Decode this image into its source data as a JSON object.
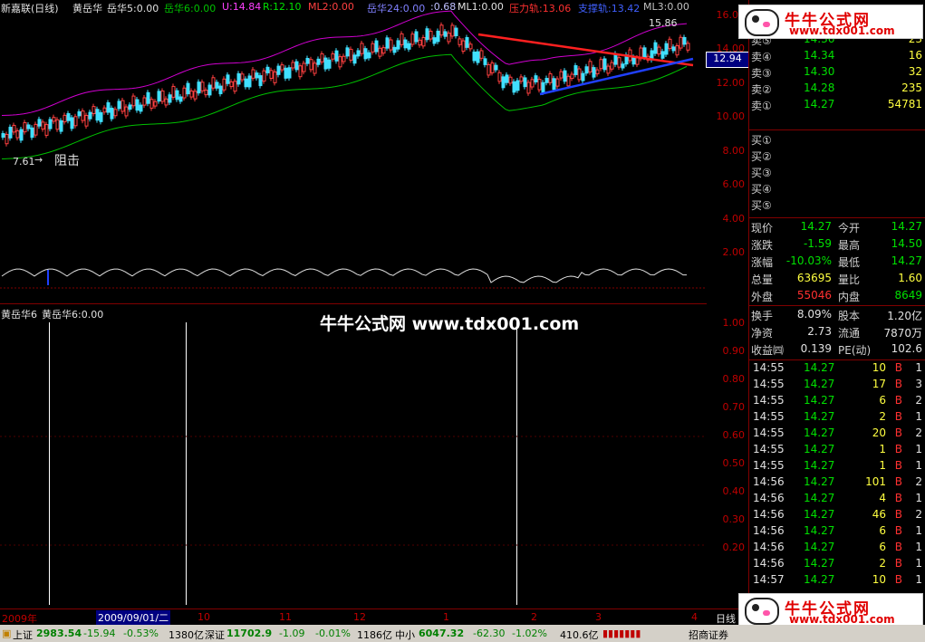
{
  "header": {
    "app_name": "新嘉联(日线)",
    "ind1": "黄岳华",
    "ind1_val": "岳华5:0.00",
    "ind2_val": "岳华6:0.00",
    "u_val": "U:14.84",
    "r_val": "R:12.10",
    "ml2_val": "ML2:0.00",
    "ind3_val": "岳华24:0.00",
    "p68": ":0.68",
    "ml1_val": "ML1:0.00",
    "pressure": "压力轨:13.06",
    "support": "支撑轨:13.42",
    "ml3_val": "ML3:0.00"
  },
  "upper_chart": {
    "price_labels": [
      "16.00",
      "14.00",
      "12.00",
      "10.00",
      "8.00",
      "6.00",
      "4.00",
      "2.00"
    ],
    "current_price_tag": "12.94",
    "high_annot": "15.86",
    "low_annot": "7.61",
    "low_annot_text": "阻击"
  },
  "lower_chart": {
    "title": "黄岳华6",
    "subtitle": "黄岳华6:0.00",
    "ticks": [
      "1.00",
      "0.90",
      "0.80",
      "0.70",
      "0.60",
      "0.50",
      "0.40",
      "0.30",
      "0.20"
    ]
  },
  "watermark": {
    "text": "牛牛公式网 www.tdx001.com",
    "logo_title": "牛牛公式网",
    "logo_url": "www.tdx001.com"
  },
  "xaxis": {
    "labels": [
      "2009年",
      "2009/09/01/二",
      "10",
      "11",
      "12",
      "1",
      "2",
      "3",
      "4",
      "日线"
    ]
  },
  "sell_orders": [
    {
      "label": "卖⑤",
      "price": "14.36",
      "vol": "23"
    },
    {
      "label": "卖④",
      "price": "14.34",
      "vol": "16"
    },
    {
      "label": "卖③",
      "price": "14.30",
      "vol": "32"
    },
    {
      "label": "卖②",
      "price": "14.28",
      "vol": "235"
    },
    {
      "label": "卖①",
      "price": "14.27",
      "vol": "54781"
    }
  ],
  "buy_orders": [
    {
      "label": "买①"
    },
    {
      "label": "买②"
    },
    {
      "label": "买③"
    },
    {
      "label": "买④"
    },
    {
      "label": "买⑤"
    }
  ],
  "quote": [
    {
      "l1": "现价",
      "v1": "14.27",
      "l2": "今开",
      "v2": "14.27"
    },
    {
      "l1": "涨跌",
      "v1": "-1.59",
      "l2": "最高",
      "v2": "14.50"
    },
    {
      "l1": "涨幅",
      "v1": "-10.03%",
      "l2": "最低",
      "v2": "14.27"
    },
    {
      "l1": "总量",
      "v1": "63695",
      "l2": "量比",
      "v2": "1.60"
    },
    {
      "l1": "外盘",
      "v1": "55046",
      "l2": "内盘",
      "v2": "8649"
    }
  ],
  "fundamentals": [
    {
      "l1": "换手",
      "v1": "8.09%",
      "l2": "股本",
      "v2": "1.20亿"
    },
    {
      "l1": "净资",
      "v1": "2.73",
      "l2": "流通",
      "v2": "7870万"
    },
    {
      "l1": "收益㈣",
      "v1": "0.139",
      "l2": "PE(动)",
      "v2": "102.6"
    }
  ],
  "ticks": [
    {
      "t": "14:55",
      "p": "14.27",
      "v": "10",
      "d": "B",
      "n": "1"
    },
    {
      "t": "14:55",
      "p": "14.27",
      "v": "17",
      "d": "B",
      "n": "3"
    },
    {
      "t": "14:55",
      "p": "14.27",
      "v": "6",
      "d": "B",
      "n": "2"
    },
    {
      "t": "14:55",
      "p": "14.27",
      "v": "2",
      "d": "B",
      "n": "1"
    },
    {
      "t": "14:55",
      "p": "14.27",
      "v": "20",
      "d": "B",
      "n": "2"
    },
    {
      "t": "14:55",
      "p": "14.27",
      "v": "1",
      "d": "B",
      "n": "1"
    },
    {
      "t": "14:55",
      "p": "14.27",
      "v": "1",
      "d": "B",
      "n": "1"
    },
    {
      "t": "14:56",
      "p": "14.27",
      "v": "101",
      "d": "B",
      "n": "2"
    },
    {
      "t": "14:56",
      "p": "14.27",
      "v": "4",
      "d": "B",
      "n": "1"
    },
    {
      "t": "14:56",
      "p": "14.27",
      "v": "46",
      "d": "B",
      "n": "2"
    },
    {
      "t": "14:56",
      "p": "14.27",
      "v": "6",
      "d": "B",
      "n": "1"
    },
    {
      "t": "14:56",
      "p": "14.27",
      "v": "6",
      "d": "B",
      "n": "1"
    },
    {
      "t": "14:56",
      "p": "14.27",
      "v": "2",
      "d": "B",
      "n": "1"
    },
    {
      "t": "14:57",
      "p": "14.27",
      "v": "10",
      "d": "B",
      "n": "1"
    }
  ],
  "status": {
    "sh_label": "上证",
    "sh_val": "2983.54",
    "sh_chg": "-15.94",
    "sh_pct": "-0.53%",
    "sh_amt": "1380亿",
    "sz_label": "深证",
    "sz_val": "11702.9",
    "sz_chg": "-1.09",
    "sz_pct": "-0.01%",
    "sz_amt": "1186亿",
    "zx_label": "中小",
    "zx_val": "6047.32",
    "zx_chg": "-62.30",
    "zx_pct": "-1.02%",
    "zx_amt": "410.6亿",
    "broker": "招商证券"
  }
}
